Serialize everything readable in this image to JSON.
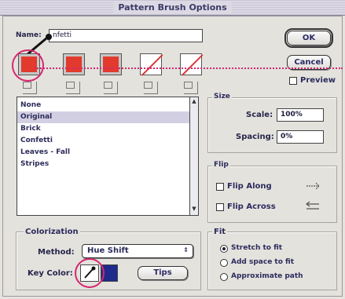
{
  "title": "Pattern Brush Options",
  "name_field": {
    "label": "Name:",
    "value": "nfetti"
  },
  "buttons": {
    "ok": "OK",
    "cancel": "Cancel",
    "tips": "Tips"
  },
  "preview": {
    "label": "Preview",
    "checked": false
  },
  "tiles": [
    {
      "name": "side-tile",
      "kind": "red"
    },
    {
      "name": "outer-corner-tile",
      "kind": "red"
    },
    {
      "name": "inner-corner-tile",
      "kind": "red"
    },
    {
      "name": "start-tile",
      "kind": "none"
    },
    {
      "name": "end-tile",
      "kind": "none"
    }
  ],
  "pattern_list": {
    "items": [
      "None",
      "Original",
      "Brick",
      "Confetti",
      "Leaves - Fall",
      "Stripes"
    ],
    "selected": "Original"
  },
  "size": {
    "title": "Size",
    "scale_label": "Scale:",
    "scale_value": "100%",
    "spacing_label": "Spacing:",
    "spacing_value": "0%"
  },
  "flip": {
    "title": "Flip",
    "along_label": "Flip Along",
    "along_checked": false,
    "across_label": "Flip Across",
    "across_checked": false
  },
  "fit": {
    "title": "Fit",
    "options": [
      "Stretch to fit",
      "Add space to fit",
      "Approximate path"
    ],
    "selected": "Stretch to fit"
  },
  "colorization": {
    "title": "Colorization",
    "method_label": "Method:",
    "method_value": "Hue Shift",
    "key_color_label": "Key Color:",
    "key_color": "#1f2a8c"
  },
  "colors": {
    "highlight": "#d6266f",
    "tile_red": "#e23a2c"
  }
}
